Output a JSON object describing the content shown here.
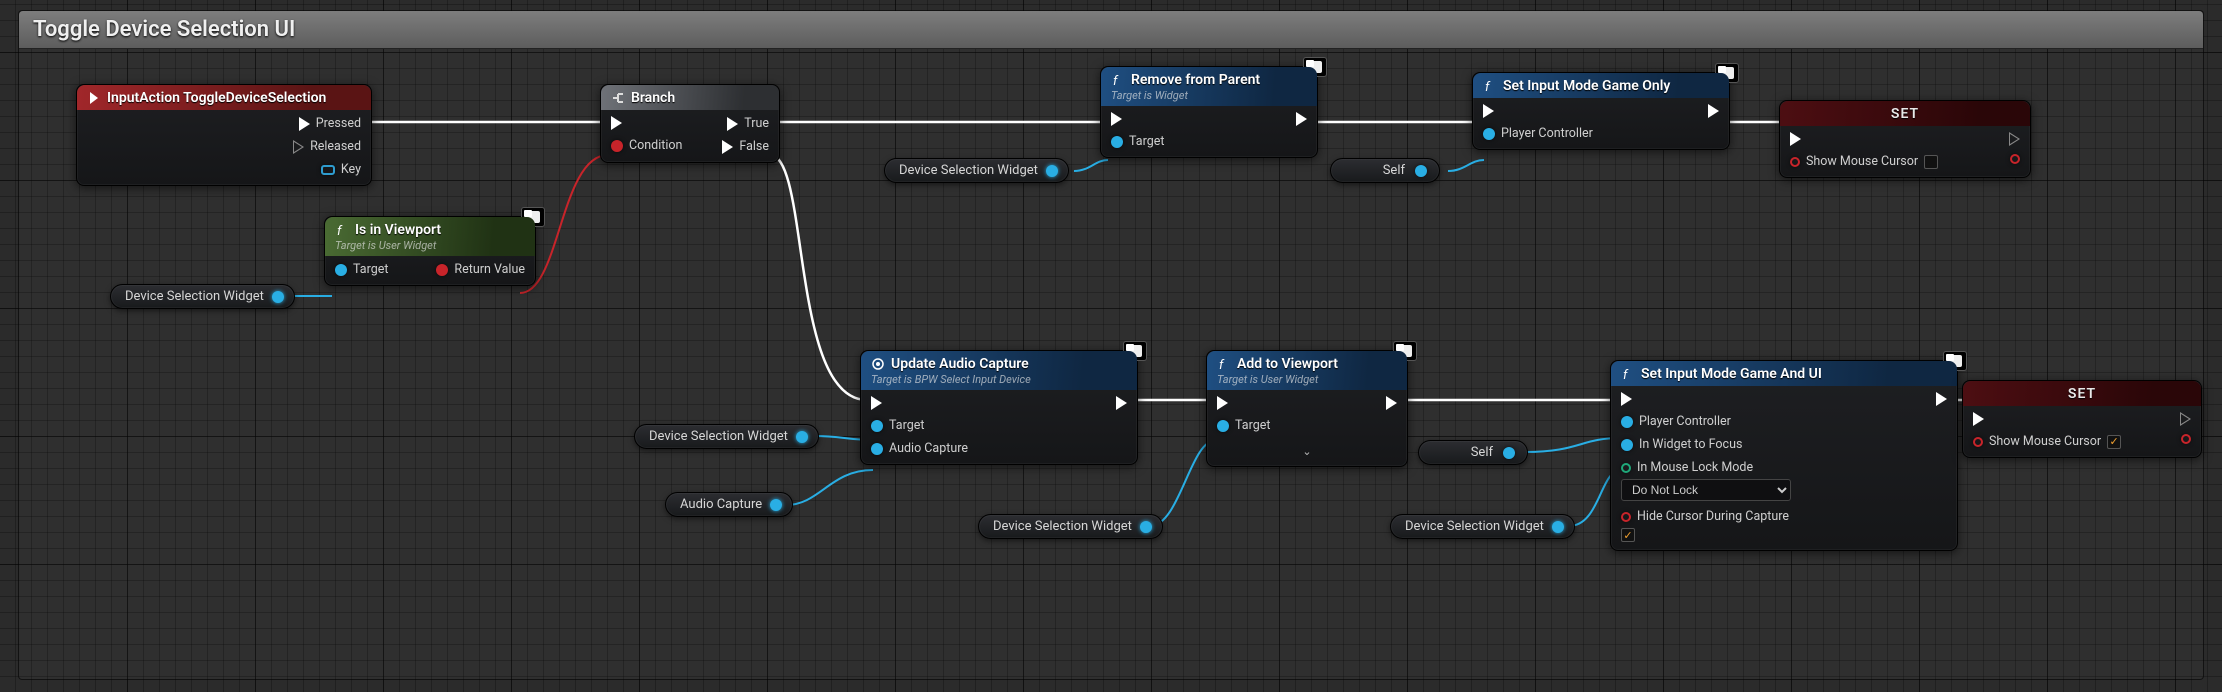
{
  "comment_title": "Toggle Device Selection UI",
  "labels": {
    "pressed": "Pressed",
    "released": "Released",
    "key": "Key",
    "true": "True",
    "false": "False",
    "condition": "Condition",
    "target": "Target",
    "return_value": "Return Value",
    "audio_capture": "Audio Capture",
    "player_controller": "Player Controller",
    "show_mouse_cursor": "Show Mouse Cursor",
    "in_widget_to_focus": "In Widget to Focus",
    "in_mouse_lock_mode": "In Mouse Lock Mode",
    "hide_cursor_during_capture": "Hide Cursor During Capture",
    "self": "Self"
  },
  "dropdown": {
    "do_not_lock": "Do Not Lock"
  },
  "nodes": {
    "input_action": {
      "title": "InputAction ToggleDeviceSelection"
    },
    "branch": {
      "title": "Branch"
    },
    "is_in_viewport": {
      "title": "Is in Viewport",
      "sub": "Target is User Widget"
    },
    "remove_from_parent": {
      "title": "Remove from Parent",
      "sub": "Target is Widget"
    },
    "set_input_game_only": {
      "title": "Set Input Mode Game Only"
    },
    "set1": {
      "title": "SET"
    },
    "update_audio_capture": {
      "title": "Update Audio Capture",
      "sub": "Target is BPW Select Input Device"
    },
    "add_to_viewport": {
      "title": "Add to Viewport",
      "sub": "Target is User Widget"
    },
    "set_input_game_and_ui": {
      "title": "Set Input Mode Game And UI"
    },
    "set2": {
      "title": "SET"
    }
  },
  "vars": {
    "device_selection_widget": "Device Selection Widget",
    "audio_capture": "Audio Capture"
  }
}
